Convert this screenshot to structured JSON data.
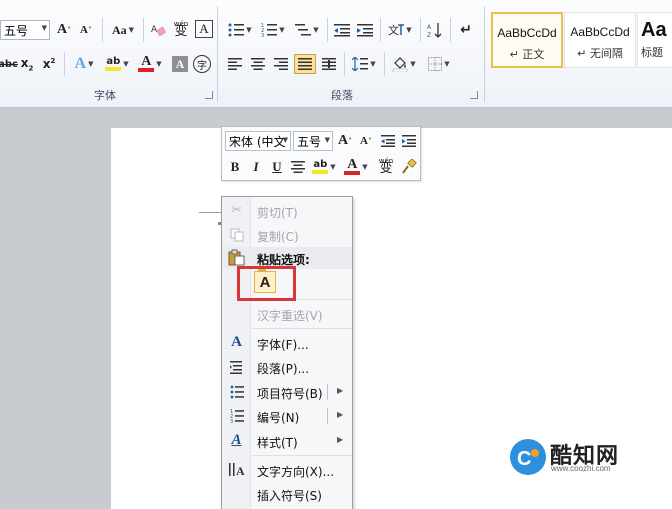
{
  "ribbon": {
    "font_group": {
      "label": "字体",
      "font_size": "五号",
      "grow_font": "A",
      "shrink_font": "A",
      "change_case": "Aa",
      "pinyin_guide": "wén",
      "phonetic_char": "变",
      "char_border": "A",
      "strikethrough": "abc",
      "subscript": "x",
      "superscript": "x",
      "text_effect": "A",
      "highlight": "ab",
      "font_color": "A",
      "char_shading": "A",
      "enclose": "字"
    },
    "paragraph_group": {
      "label": "段落"
    },
    "styles_group": {
      "styles": [
        {
          "preview": "AaBbCcDd",
          "name": "↵ 正文"
        },
        {
          "preview": "AaBbCcDd",
          "name": "↵ 无间隔"
        },
        {
          "preview": "Aa",
          "name": "标题"
        }
      ]
    }
  },
  "mini_toolbar": {
    "font_name": "宋体 (中文",
    "font_size": "五号",
    "grow": "A",
    "shrink": "A",
    "bold": "B",
    "italic": "I",
    "underline": "U",
    "highlight": "ab",
    "font_color": "A",
    "phonetic": "wén",
    "phonetic_char": "变"
  },
  "context_menu": {
    "items": [
      {
        "label": "剪切(T)",
        "icon": "scissors-icon",
        "disabled": true
      },
      {
        "label": "复制(C)",
        "icon": "copy-icon",
        "disabled": true
      },
      {
        "label": "粘贴选项:",
        "icon": "clipboard-icon",
        "heading": true
      },
      {
        "label": "汉字重选(V)",
        "disabled": true
      },
      {
        "label": "字体(F)...",
        "icon": "font-icon"
      },
      {
        "label": "段落(P)...",
        "icon": "paragraph-icon"
      },
      {
        "label": "项目符号(B)",
        "icon": "bullets-icon",
        "submenu": true
      },
      {
        "label": "编号(N)",
        "icon": "numbering-icon",
        "submenu": true
      },
      {
        "label": "样式(T)",
        "icon": "styles-icon",
        "submenu": true
      },
      {
        "label": "文字方向(X)...",
        "icon": "text-direction-icon"
      },
      {
        "label": "插入符号(S)",
        "icon": ""
      }
    ],
    "paste_option": "A"
  },
  "watermark": {
    "brand": "酷知网",
    "url": "www.coozhi.com"
  },
  "colors": {
    "highlight_box": "#d9343a",
    "font_color_red": "#e02020",
    "highlight_yellow": "#f6e626",
    "logo_blue": "#2e8fdc"
  }
}
